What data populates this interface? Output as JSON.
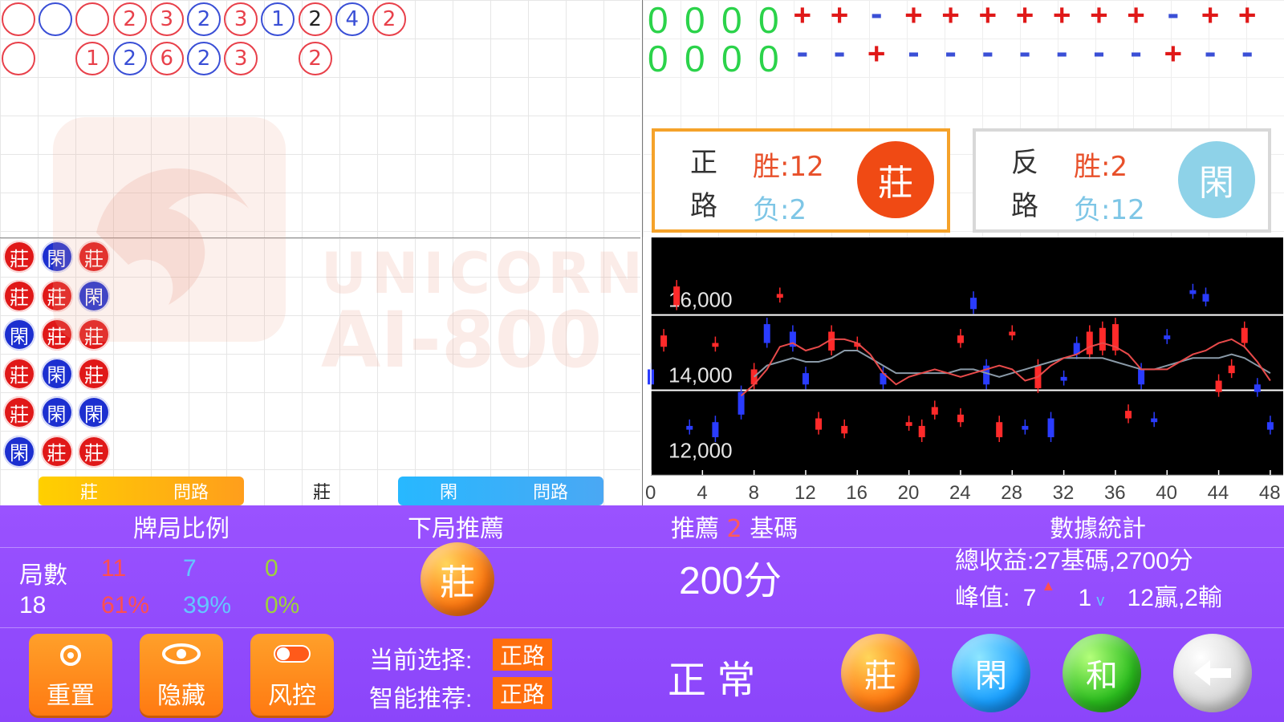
{
  "bead_road": {
    "row1": [
      {
        "text": "",
        "color": "red"
      },
      {
        "text": "",
        "color": "blue"
      },
      {
        "text": "",
        "color": "red"
      },
      {
        "text": "2",
        "color": "red"
      },
      {
        "text": "3",
        "color": "red"
      },
      {
        "text": "2",
        "color": "blue"
      },
      {
        "text": "3",
        "color": "red"
      },
      {
        "text": "1",
        "color": "blue"
      },
      {
        "text": "2",
        "color": "black"
      },
      {
        "text": "4",
        "color": "blue"
      },
      {
        "text": "2",
        "color": "red"
      }
    ],
    "row2": [
      {
        "text": "",
        "color": "red",
        "col": 0
      },
      {
        "text": "1",
        "color": "red",
        "col": 2
      },
      {
        "text": "2",
        "color": "blue",
        "col": 3
      },
      {
        "text": "6",
        "color": "red",
        "col": 4
      },
      {
        "text": "2",
        "color": "blue",
        "col": 5
      },
      {
        "text": "3",
        "color": "red",
        "col": 6
      },
      {
        "text": "2",
        "color": "red",
        "col": 8
      }
    ]
  },
  "watermark": {
    "line1": "UNICORN",
    "line2": "AI-800"
  },
  "pm_road": {
    "zeros_row1": [
      "0",
      "0",
      "0",
      "0"
    ],
    "zeros_row2": [
      "0",
      "0",
      "0",
      "0"
    ],
    "signs_row1": [
      "+",
      "+",
      "-",
      "+",
      "+",
      "+",
      "+",
      "+",
      "+",
      "+",
      "-",
      "+",
      "+"
    ],
    "signs_row2": [
      "-",
      "-",
      "+",
      "-",
      "-",
      "-",
      "-",
      "-",
      "-",
      "-",
      "+",
      "-",
      "-"
    ]
  },
  "positive_road": {
    "name_line1": "正",
    "name_line2": "路",
    "win": "胜:12",
    "loss": "负:2",
    "badge": "莊"
  },
  "negative_road": {
    "name_line1": "反",
    "name_line2": "路",
    "win": "胜:2",
    "loss": "负:12",
    "badge": "閑"
  },
  "big_road": {
    "columns": [
      [
        {
          "t": "莊",
          "c": "red"
        },
        {
          "t": "莊",
          "c": "red"
        },
        {
          "t": "閑",
          "c": "blue"
        },
        {
          "t": "莊",
          "c": "red"
        },
        {
          "t": "莊",
          "c": "red"
        },
        {
          "t": "閑",
          "c": "blue"
        }
      ],
      [
        {
          "t": "閑",
          "c": "blue"
        },
        {
          "t": "莊",
          "c": "red"
        },
        {
          "t": "莊",
          "c": "red"
        },
        {
          "t": "閑",
          "c": "blue"
        },
        {
          "t": "閑",
          "c": "blue"
        },
        {
          "t": "莊",
          "c": "red"
        }
      ],
      [
        {
          "t": "莊",
          "c": "red"
        },
        {
          "t": "閑",
          "c": "blue"
        },
        {
          "t": "莊",
          "c": "red"
        },
        {
          "t": "莊",
          "c": "red"
        },
        {
          "t": "閑",
          "c": "blue"
        },
        {
          "t": "莊",
          "c": "red"
        }
      ]
    ]
  },
  "ask_road": {
    "banker_btn": {
      "left": "莊",
      "right": "問路"
    },
    "mid_label": "莊",
    "player_btn": {
      "left": "閑",
      "right": "問路"
    }
  },
  "chart_data": {
    "type": "candlestick",
    "y_ticks": [
      "16,000",
      "14,000",
      "12,000"
    ],
    "x_ticks": [
      "0",
      "4",
      "8",
      "12",
      "16",
      "20",
      "24",
      "28",
      "32",
      "36",
      "40",
      "44",
      "48"
    ],
    "ylim": [
      11500,
      17800
    ],
    "xlim": [
      0,
      49
    ],
    "candles": [
      {
        "x": 0,
        "open": 14300,
        "close": 13900,
        "color": "blue"
      },
      {
        "x": 2,
        "open": 16500,
        "close": 16000,
        "color": "red"
      },
      {
        "x": 1,
        "open": 15200,
        "close": 14900,
        "color": "red"
      },
      {
        "x": 3,
        "open": 12800,
        "close": 12700,
        "color": "blue"
      },
      {
        "x": 5,
        "open": 15000,
        "close": 14900,
        "color": "red"
      },
      {
        "x": 5,
        "open": 12900,
        "close": 12500,
        "color": "blue"
      },
      {
        "x": 7,
        "open": 13700,
        "close": 13100,
        "color": "blue"
      },
      {
        "x": 8,
        "open": 14300,
        "close": 13900,
        "color": "red"
      },
      {
        "x": 10,
        "open": 16300,
        "close": 16200,
        "color": "red"
      },
      {
        "x": 9,
        "open": 15500,
        "close": 15000,
        "color": "blue"
      },
      {
        "x": 11,
        "open": 15300,
        "close": 14900,
        "color": "blue"
      },
      {
        "x": 12,
        "open": 14200,
        "close": 13900,
        "color": "blue"
      },
      {
        "x": 13,
        "open": 13000,
        "close": 12700,
        "color": "red"
      },
      {
        "x": 14,
        "open": 15300,
        "close": 14800,
        "color": "red"
      },
      {
        "x": 15,
        "open": 12800,
        "close": 12600,
        "color": "red"
      },
      {
        "x": 16,
        "open": 15000,
        "close": 14900,
        "color": "red"
      },
      {
        "x": 18,
        "open": 14200,
        "close": 13900,
        "color": "blue"
      },
      {
        "x": 20,
        "open": 12900,
        "close": 12800,
        "color": "red"
      },
      {
        "x": 21,
        "open": 12800,
        "close": 12500,
        "color": "red"
      },
      {
        "x": 22,
        "open": 13300,
        "close": 13100,
        "color": "red"
      },
      {
        "x": 24,
        "open": 13100,
        "close": 12900,
        "color": "red"
      },
      {
        "x": 25,
        "open": 16200,
        "close": 15900,
        "color": "blue"
      },
      {
        "x": 24,
        "open": 15200,
        "close": 15000,
        "color": "red"
      },
      {
        "x": 26,
        "open": 14400,
        "close": 13900,
        "color": "blue"
      },
      {
        "x": 27,
        "open": 12900,
        "close": 12500,
        "color": "red"
      },
      {
        "x": 28,
        "open": 15300,
        "close": 15200,
        "color": "red"
      },
      {
        "x": 29,
        "open": 12800,
        "close": 12700,
        "color": "blue"
      },
      {
        "x": 30,
        "open": 14400,
        "close": 13800,
        "color": "red"
      },
      {
        "x": 31,
        "open": 13000,
        "close": 12500,
        "color": "blue"
      },
      {
        "x": 32,
        "open": 14100,
        "close": 14000,
        "color": "blue"
      },
      {
        "x": 33,
        "open": 15000,
        "close": 14700,
        "color": "blue"
      },
      {
        "x": 34,
        "open": 15300,
        "close": 14700,
        "color": "red"
      },
      {
        "x": 35,
        "open": 15400,
        "close": 14800,
        "color": "red"
      },
      {
        "x": 36,
        "open": 15500,
        "close": 14800,
        "color": "red"
      },
      {
        "x": 37,
        "open": 13200,
        "close": 13000,
        "color": "red"
      },
      {
        "x": 38,
        "open": 14300,
        "close": 13900,
        "color": "blue"
      },
      {
        "x": 39,
        "open": 13000,
        "close": 12900,
        "color": "blue"
      },
      {
        "x": 40,
        "open": 15200,
        "close": 15100,
        "color": "blue"
      },
      {
        "x": 42,
        "open": 16400,
        "close": 16300,
        "color": "blue"
      },
      {
        "x": 43,
        "open": 16300,
        "close": 16100,
        "color": "blue"
      },
      {
        "x": 44,
        "open": 14000,
        "close": 13700,
        "color": "red"
      },
      {
        "x": 45,
        "open": 14400,
        "close": 14200,
        "color": "red"
      },
      {
        "x": 46,
        "open": 15400,
        "close": 15000,
        "color": "red"
      },
      {
        "x": 47,
        "open": 13900,
        "close": 13700,
        "color": "blue"
      },
      {
        "x": 48,
        "open": 12900,
        "close": 12700,
        "color": "blue"
      }
    ],
    "red_line": [
      [
        7,
        13600
      ],
      [
        8,
        13900
      ],
      [
        9,
        14300
      ],
      [
        10,
        14900
      ],
      [
        11,
        15000
      ],
      [
        12,
        14800
      ],
      [
        13,
        14900
      ],
      [
        14,
        15100
      ],
      [
        15,
        15100
      ],
      [
        16,
        15000
      ],
      [
        17,
        14700
      ],
      [
        18,
        14200
      ],
      [
        19,
        13900
      ],
      [
        20,
        14100
      ],
      [
        21,
        14200
      ],
      [
        22,
        14300
      ],
      [
        23,
        14200
      ],
      [
        24,
        14100
      ],
      [
        25,
        14200
      ],
      [
        26,
        14300
      ],
      [
        27,
        14400
      ],
      [
        28,
        14300
      ],
      [
        29,
        14000
      ],
      [
        30,
        14100
      ],
      [
        31,
        14400
      ],
      [
        32,
        14600
      ],
      [
        33,
        14700
      ],
      [
        34,
        14900
      ],
      [
        35,
        15000
      ],
      [
        36,
        14900
      ],
      [
        37,
        14700
      ],
      [
        38,
        14300
      ],
      [
        39,
        14300
      ],
      [
        40,
        14300
      ],
      [
        41,
        14500
      ],
      [
        42,
        14700
      ],
      [
        43,
        14800
      ],
      [
        44,
        15000
      ],
      [
        45,
        15100
      ],
      [
        46,
        14900
      ],
      [
        47,
        14500
      ],
      [
        48,
        14000
      ]
    ],
    "grey_line": [
      [
        8,
        14100
      ],
      [
        9,
        14400
      ],
      [
        10,
        14500
      ],
      [
        11,
        14600
      ],
      [
        12,
        14500
      ],
      [
        13,
        14500
      ],
      [
        14,
        14600
      ],
      [
        15,
        14800
      ],
      [
        16,
        14800
      ],
      [
        17,
        14600
      ],
      [
        18,
        14400
      ],
      [
        19,
        14200
      ],
      [
        20,
        14200
      ],
      [
        21,
        14200
      ],
      [
        22,
        14200
      ],
      [
        23,
        14200
      ],
      [
        24,
        14300
      ],
      [
        25,
        14300
      ],
      [
        26,
        14200
      ],
      [
        27,
        14100
      ],
      [
        28,
        14200
      ],
      [
        29,
        14300
      ],
      [
        30,
        14400
      ],
      [
        31,
        14500
      ],
      [
        32,
        14600
      ],
      [
        33,
        14600
      ],
      [
        34,
        14600
      ],
      [
        35,
        14600
      ],
      [
        36,
        14500
      ],
      [
        37,
        14400
      ],
      [
        38,
        14300
      ],
      [
        39,
        14300
      ],
      [
        40,
        14400
      ],
      [
        41,
        14500
      ],
      [
        42,
        14600
      ],
      [
        43,
        14600
      ],
      [
        44,
        14600
      ],
      [
        45,
        14700
      ],
      [
        46,
        14600
      ],
      [
        47,
        14400
      ],
      [
        48,
        14200
      ]
    ]
  },
  "panel": {
    "titles": {
      "ratio": "牌局比例",
      "next": "下局推薦",
      "recommend_prefix": "推薦",
      "recommend_num": "2",
      "recommend_suffix": "基碼",
      "stats": "數據統計"
    },
    "ratio": {
      "label_rounds": "局數",
      "banker_count": "11",
      "player_count": "7",
      "tie_count": "0",
      "total": "18",
      "banker_pct": "61%",
      "player_pct": "39%",
      "tie_pct": "0%"
    },
    "next_ball": "莊",
    "bet_amount": "200分",
    "stats": {
      "total": "總收益:27基碼,2700分",
      "peak_label": "峰值:",
      "peak_up": "7",
      "peak_down": "1",
      "record": "12贏,2輸"
    },
    "buttons": {
      "reset": "重置",
      "hide": "隐藏",
      "risk": "风控"
    },
    "current_choice_label": "当前选择:",
    "current_choice": "正路",
    "smart_label": "智能推荐:",
    "smart_choice": "正路",
    "status": "正 常",
    "bet_balls": {
      "banker": "莊",
      "player": "閑",
      "tie": "和"
    }
  },
  "colors": {
    "banker": "#e01818",
    "player": "#1c2fd0",
    "panel": "#9a52ff",
    "accent": "#ff7a12",
    "tie": "#2bb82b"
  }
}
